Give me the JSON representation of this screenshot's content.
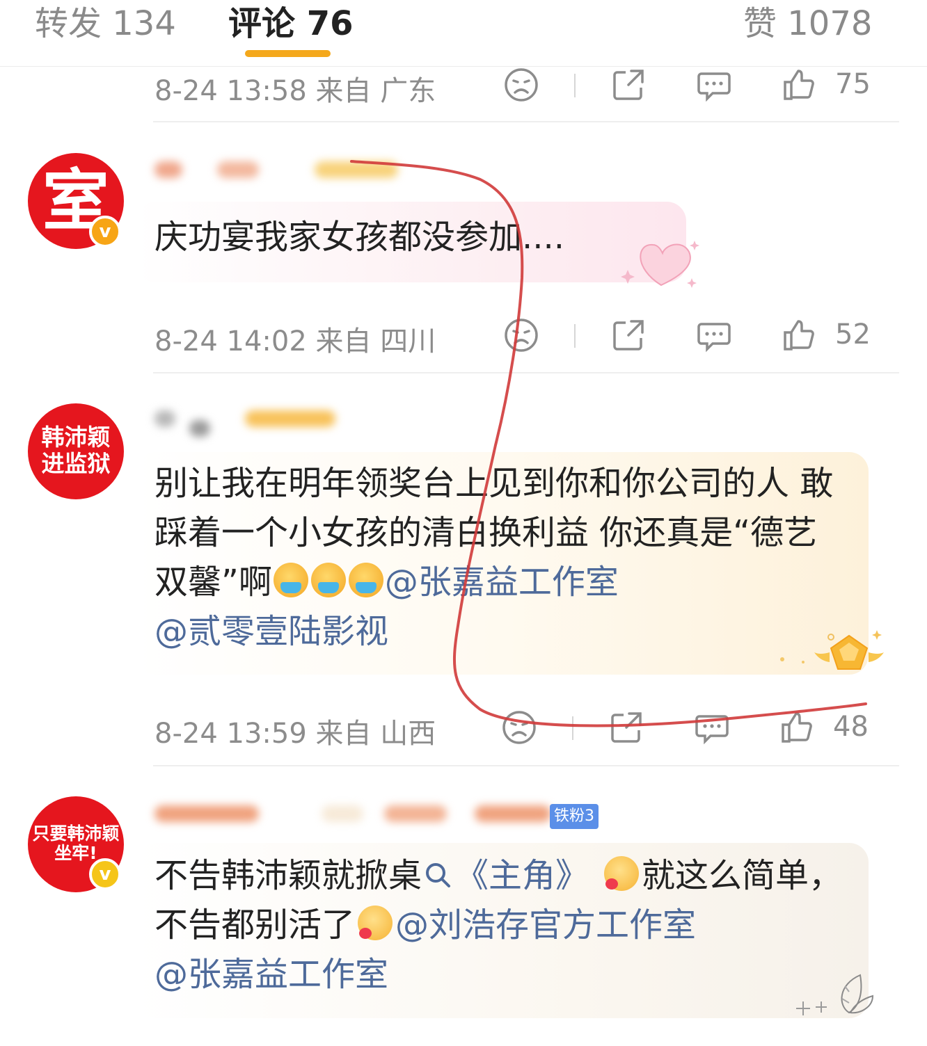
{
  "tabs": {
    "repost": "转发 134",
    "comments": "评论 76",
    "likes": "赞 1078"
  },
  "comments": [
    {
      "time_location": "8-24 13:58  来自 广东",
      "like_count": "75"
    },
    {
      "avatar_text": "室",
      "verified_mark": "v",
      "text": "庆功宴我家女孩都没参加....",
      "time_location": "8-24 14:02  来自 四川",
      "like_count": "52"
    },
    {
      "avatar_text": "韩沛颖进监狱",
      "avatar_line1": "韩沛颖",
      "avatar_line2": "进监狱",
      "text_part1": "别让我在明年领奖台上见到你和你公司的人  敢踩着一个小女孩的清白换利益 你还真是“德艺双馨”啊",
      "mention1": "@张嘉益工作室",
      "mention2": "@贰零壹陆影视",
      "time_location": "8-24 13:59  来自 山西",
      "like_count": "48"
    },
    {
      "avatar_line1": "只要韩沛颖",
      "avatar_line2": "坐牢!",
      "verified_mark": "v",
      "fan_badge": "铁粉3",
      "text_part1": "不告韩沛颖就掀桌",
      "search_link": "《主角》",
      "text_part2": "就这么简单，不告都别活了",
      "mention1": "@刘浩存官方工作室",
      "mention2": "@张嘉益工作室"
    }
  ],
  "icons": [
    "sad-face-icon",
    "share-icon",
    "comment-icon",
    "thumbs-up-icon",
    "search-icon",
    "emoji-icon"
  ],
  "colors": {
    "accent_underline": "#f4a81c",
    "mention": "#4e6a9a",
    "avatar_red": "#e5161e",
    "annotation_red": "#d03a3a"
  }
}
